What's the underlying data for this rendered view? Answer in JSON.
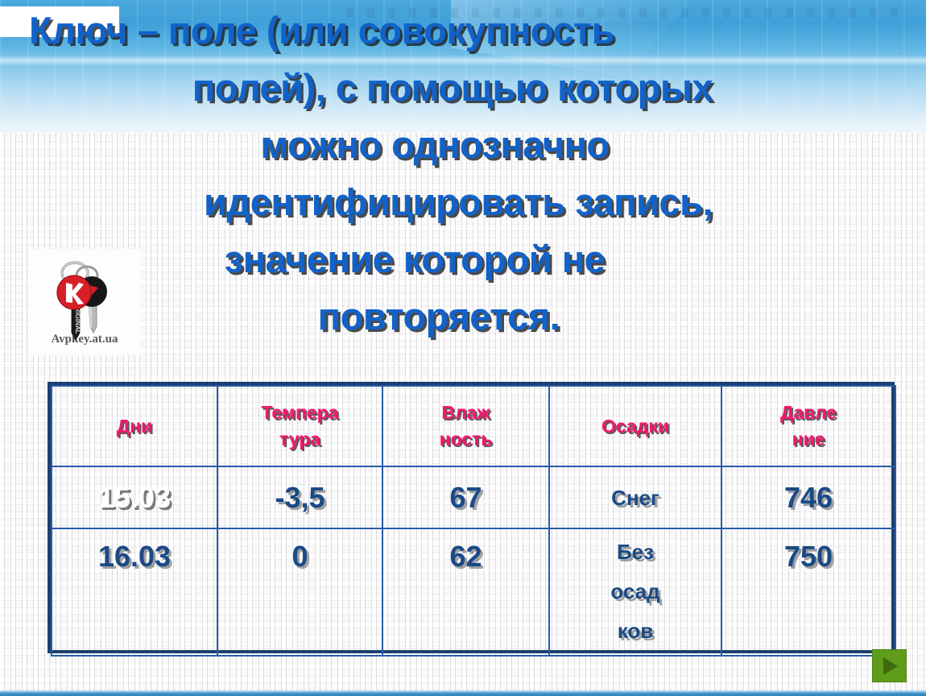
{
  "slide": {
    "headline_lines": [
      "Ключ – поле (или совокупность",
      "полей), с помощью которых",
      "можно однозначно",
      "идентифицировать запись,",
      "значение которой не",
      "повторяется."
    ],
    "headline_color": "#1262c8",
    "banner_color_top": "#4ba8dd",
    "banner_color_bottom": "#eef6fc",
    "background_color": "#e8e8e8"
  },
  "key_image": {
    "alt": "keys-photo",
    "watermark": "Avpkey.at.ua",
    "key_label": "ORIGINAL",
    "badge_letter": "K",
    "badge_color": "#d81f26"
  },
  "table": {
    "header_color": "#f5176e",
    "value_color": "#1a4a86",
    "border_color": "#1b3f70",
    "inner_border_color": "#2a5ba8",
    "columns": [
      {
        "id": "dni",
        "label": "Дни",
        "lines": [
          "Дни"
        ]
      },
      {
        "id": "temp",
        "label": "Температура",
        "lines": [
          "Темпера",
          "тура"
        ]
      },
      {
        "id": "humidity",
        "label": "Влажность",
        "lines": [
          "Влаж",
          "ность"
        ]
      },
      {
        "id": "precip",
        "label": "Осадки",
        "lines": [
          "Осадки"
        ]
      },
      {
        "id": "pressure",
        "label": "Давление",
        "lines": [
          "Давле",
          "ние"
        ]
      }
    ],
    "rows": [
      {
        "dni": "15.03",
        "temp": "-3,5",
        "humidity": "67",
        "precip_lines": [
          "Снег"
        ],
        "pressure": "746"
      },
      {
        "dni": "16.03",
        "temp": "0",
        "humidity": "62",
        "precip_lines": [
          "Без",
          "осад",
          "ков"
        ],
        "pressure": "750"
      }
    ]
  },
  "next_button": {
    "icon": "play-triangle-icon",
    "label": "",
    "color": "#5f9c1a"
  }
}
